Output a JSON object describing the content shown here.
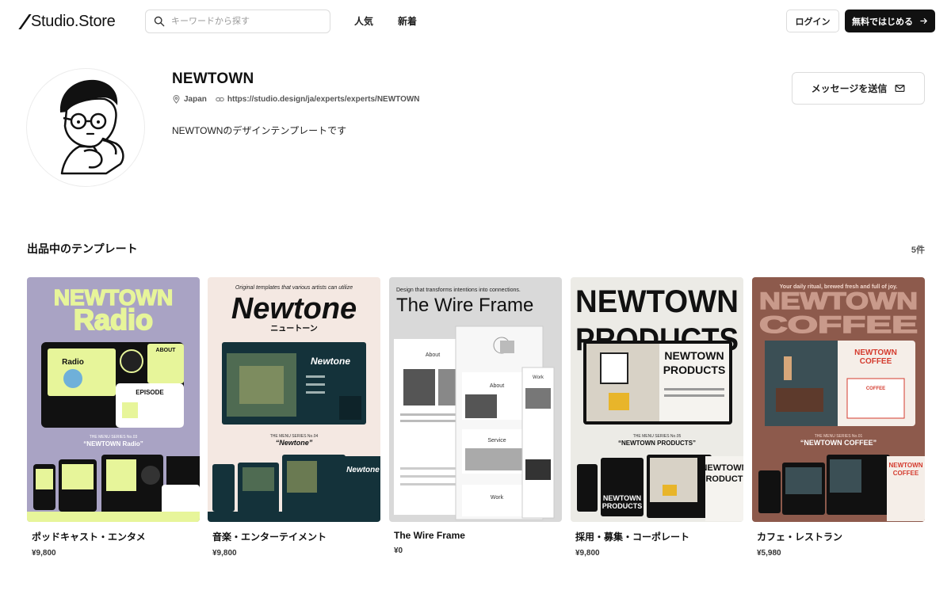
{
  "header": {
    "logo_text": "Studio.Store",
    "search_placeholder": "キーワードから探す",
    "nav": [
      "人気",
      "新着"
    ],
    "login_label": "ログイン",
    "start_label": "無料ではじめる"
  },
  "profile": {
    "name": "NEWTOWN",
    "location": "Japan",
    "url": "https://studio.design/ja/experts/experts/NEWTOWN",
    "bio": "NEWTOWNのデザインテンプレートです",
    "message_label": "メッセージを送信"
  },
  "templates": {
    "title": "出品中のテンプレート",
    "count": "5件",
    "items": [
      {
        "title": "ポッドキャスト・エンタメ",
        "price": "¥9,800",
        "thumb": {
          "line1": "NEWTOWN",
          "line2": "Radio",
          "series": "THE MENU SERIES No.03",
          "caption": "“NEWTOWN Radio”",
          "panel_title": "Radio",
          "about": "ABOUT",
          "episode": "EPISODE"
        }
      },
      {
        "title": "音楽・エンターテイメント",
        "price": "¥9,800",
        "thumb": {
          "tagline": "Original templates that various artists can utilize",
          "logo": "Newtone",
          "sub": "ニュートーン",
          "series": "THE MENU SERIES No.04",
          "caption": "“Newtone”"
        }
      },
      {
        "title": "The Wire Frame",
        "price": "¥0",
        "thumb": {
          "tagline": "Design that transforms intentions into connections.",
          "heading": "The Wire Frame",
          "about": "About",
          "work": "Work",
          "service": "Service"
        }
      },
      {
        "title": "採用・募集・コーポレート",
        "price": "¥9,800",
        "thumb": {
          "line1": "NEWTOWN",
          "line2": "PRODUCTS",
          "series": "THE MENU SERIES No.05",
          "caption": "“NEWTOWN PRODUCTS”"
        }
      },
      {
        "title": "カフェ・レストラン",
        "price": "¥5,980",
        "thumb": {
          "tagline": "Your daily ritual, brewed fresh and full of joy.",
          "line1": "NEWTOWN",
          "line2": "COFFEE",
          "series": "THE MENU SERIES No.01",
          "caption": "“NEWTOWN COFFEE”",
          "label": "COFFEE"
        }
      }
    ]
  },
  "colors": {
    "accent": "#111111",
    "radio_bg": "#a9a3c4",
    "radio_lime": "#e7f59a",
    "newtone_bg": "#f4e8e2",
    "newtone_dark": "#14323a",
    "wire_bg": "#d9d9d9",
    "products_bg": "#ecebe6",
    "coffee_bg": "#8d5a4c",
    "coffee_red": "#d43b2e"
  }
}
